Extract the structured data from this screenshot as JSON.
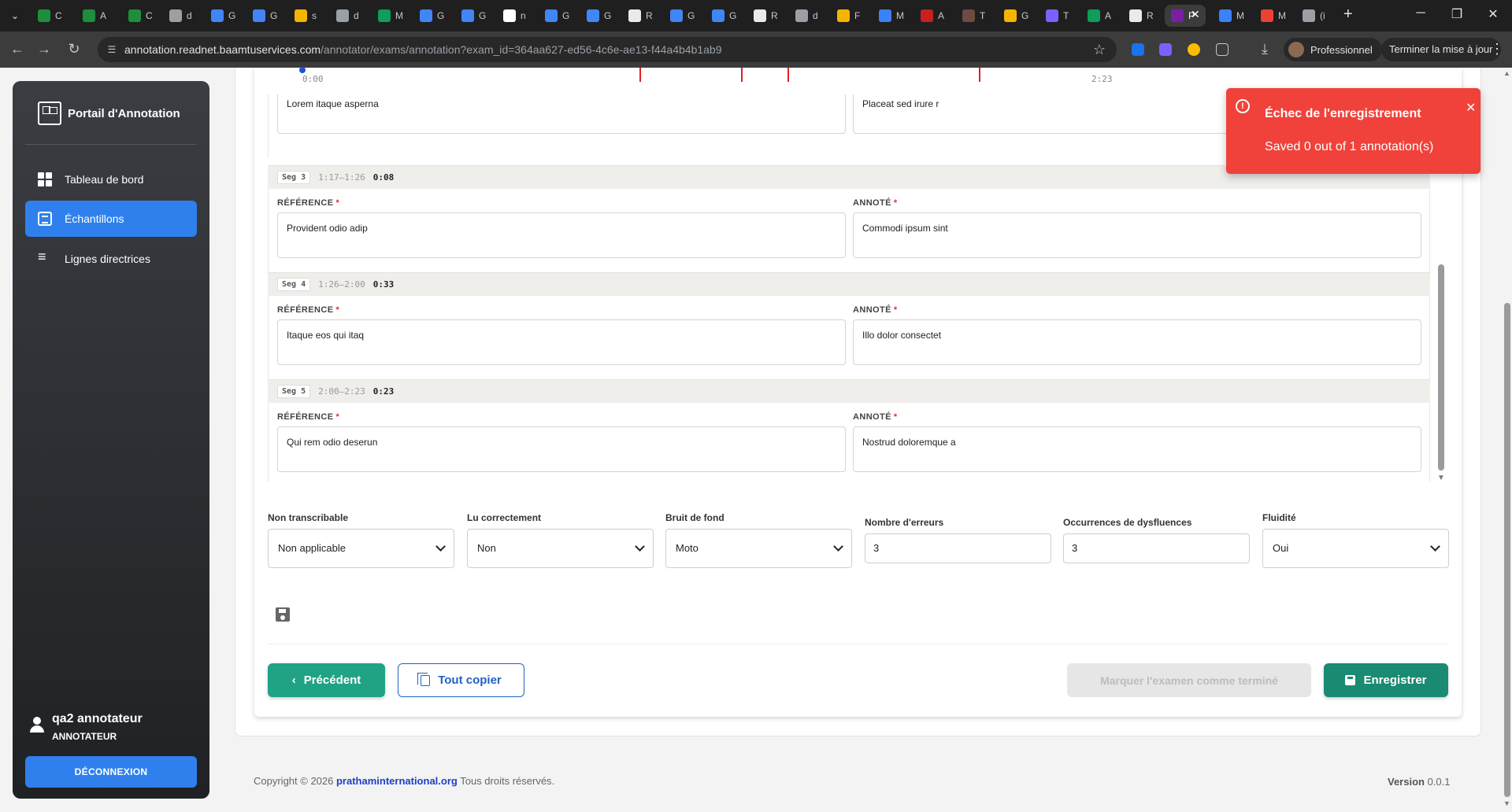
{
  "browser": {
    "tabs": [
      {
        "letter": "C",
        "color": "#1e8e3e"
      },
      {
        "letter": "A",
        "color": "#1e8e3e"
      },
      {
        "letter": "C",
        "color": "#1e8e3e"
      },
      {
        "letter": "d",
        "color": "#9aa0a6"
      },
      {
        "letter": "G",
        "color": "#4285f4"
      },
      {
        "letter": "G",
        "color": "#4285f4"
      },
      {
        "letter": "s",
        "color": "#f4b400"
      },
      {
        "letter": "d",
        "color": "#9aa0a6"
      },
      {
        "letter": "M",
        "color": "#0f9d58"
      },
      {
        "letter": "G",
        "color": "#4285f4"
      },
      {
        "letter": "G",
        "color": "#4285f4"
      },
      {
        "letter": "n",
        "color": "#ffffff"
      },
      {
        "letter": "G",
        "color": "#4285f4"
      },
      {
        "letter": "G",
        "color": "#4285f4"
      },
      {
        "letter": "R",
        "color": "#e8eaed"
      },
      {
        "letter": "G",
        "color": "#4285f4"
      },
      {
        "letter": "G",
        "color": "#4285f4"
      },
      {
        "letter": "R",
        "color": "#e8eaed"
      },
      {
        "letter": "d",
        "color": "#9aa0a6"
      },
      {
        "letter": "F",
        "color": "#f4b400"
      },
      {
        "letter": "M",
        "color": "#3b82f6"
      },
      {
        "letter": "A",
        "color": "#c5221f"
      },
      {
        "letter": "T",
        "color": "#6d4c41"
      },
      {
        "letter": "G",
        "color": "#f4b400"
      },
      {
        "letter": "T",
        "color": "#7b61ff"
      },
      {
        "letter": "A",
        "color": "#0f9d58"
      },
      {
        "letter": "R",
        "color": "#e8eaed"
      },
      {
        "letter": "P",
        "color": "#7b1fa2"
      },
      {
        "letter": "M",
        "color": "#3b82f6"
      },
      {
        "letter": "M",
        "color": "#ea4335"
      },
      {
        "letter": "(i",
        "color": "#9aa0a6"
      }
    ],
    "url_host": "annotation.readnet.baamtuservices.com",
    "url_path": "/annotator/exams/annotation?exam_id=364aa627-ed56-4c6e-ae13-f44a4b4b1ab9",
    "profile_label": "Professionnel",
    "update_label": "Terminer la mise à jour"
  },
  "sidebar": {
    "brand": "Portail d'Annotation",
    "items": [
      {
        "label": "Tableau de bord",
        "icon": "dashboard-icon",
        "active": false
      },
      {
        "label": "Échantillons",
        "icon": "list-icon",
        "active": true
      },
      {
        "label": "Lignes directrices",
        "icon": "guidelines-icon",
        "active": false
      }
    ],
    "user_name": "qa2 annotateur",
    "user_role": "ANNOTATEUR",
    "logout_label": "DÉCONNEXION"
  },
  "timeline": {
    "start": "0:00",
    "end": "2:23"
  },
  "segments": {
    "partial": {
      "reference": "Lorem itaque asperna",
      "annotated": "Placeat sed irure r"
    },
    "reference_label": "RÉFÉRENCE",
    "annotated_label": "ANNOTÉ",
    "items": [
      {
        "tag": "Seg 3",
        "range": "1:17–1:26",
        "duration": "0:08",
        "reference": "Provident odio adip",
        "annotated": "Commodi ipsum sint"
      },
      {
        "tag": "Seg 4",
        "range": "1:26–2:00",
        "duration": "0:33",
        "reference": "Itaque eos qui itaq",
        "annotated": "Illo dolor consectet"
      },
      {
        "tag": "Seg 5",
        "range": "2:00–2:23",
        "duration": "0:23",
        "reference": "Qui rem odio deserun",
        "annotated": "Nostrud doloremque a"
      }
    ]
  },
  "fields": {
    "non_transcribable": {
      "label": "Non transcribable",
      "value": "Non applicable"
    },
    "lu_correctement": {
      "label": "Lu correctement",
      "value": "Non"
    },
    "bruit_de_fond": {
      "label": "Bruit de fond",
      "value": "Moto"
    },
    "nombre_erreurs": {
      "label": "Nombre d'erreurs",
      "value": "3"
    },
    "dysfluences": {
      "label": "Occurrences de dysfluences",
      "value": "3"
    },
    "fluidite": {
      "label": "Fluidité",
      "value": "Oui"
    }
  },
  "actions": {
    "previous": "Précédent",
    "copy_all": "Tout copier",
    "mark_done": "Marquer l'examen comme terminé",
    "save": "Enregistrer"
  },
  "footer": {
    "copyright_prefix": "Copyright © 2026",
    "link": "prathaminternational.org",
    "copyright_suffix": "Tous droits réservés.",
    "version_label": "Version",
    "version": "0.0.1"
  },
  "toast": {
    "title": "Échec de l'enregistrement",
    "message": "Saved 0 out of 1 annotation(s)"
  },
  "colors": {
    "accent": "#2f80ed",
    "primary_action": "#1a8a72",
    "error": "#f0423a"
  }
}
